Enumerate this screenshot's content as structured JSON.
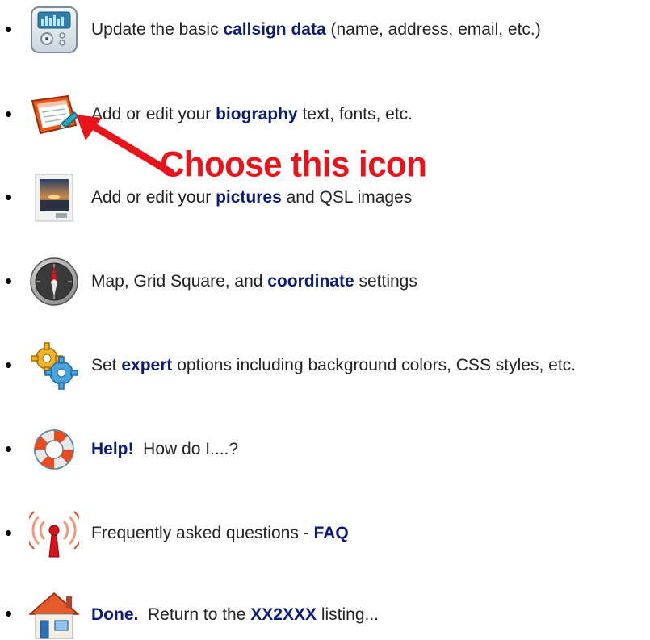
{
  "items": [
    {
      "pre": "Update the basic ",
      "bold": "callsign data",
      "post": " (name, address, email, etc.)",
      "icon": "control-panel-icon"
    },
    {
      "pre": "Add or edit your ",
      "bold": "biography",
      "post": " text, fonts, etc.",
      "icon": "edit-document-icon"
    },
    {
      "pre": "Add or edit your ",
      "bold": "pictures",
      "post": " and QSL images",
      "icon": "picture-icon"
    },
    {
      "pre": "Map, Grid Square, and ",
      "bold": "coordinate",
      "post": " settings",
      "icon": "compass-icon"
    },
    {
      "pre": "Set ",
      "bold": "expert",
      "post": " options including background colors, CSS styles, etc.",
      "icon": "gears-icon"
    },
    {
      "pre": "",
      "bold": "Help!",
      "post": "  How do I....?",
      "icon": "lifebuoy-icon"
    },
    {
      "pre": "Frequently asked questions - ",
      "bold": "FAQ",
      "post": "",
      "icon": "antenna-icon"
    },
    {
      "pre": "",
      "bold": "Done.",
      "post": "  Return to the ",
      "bold2": "XX2XXX",
      "post2": " listing...",
      "icon": "home-icon"
    }
  ],
  "callout": {
    "text": "Choose this icon",
    "color": "#e8141c"
  },
  "colors": {
    "link_bold": "#0c1a78",
    "text": "#222222"
  }
}
